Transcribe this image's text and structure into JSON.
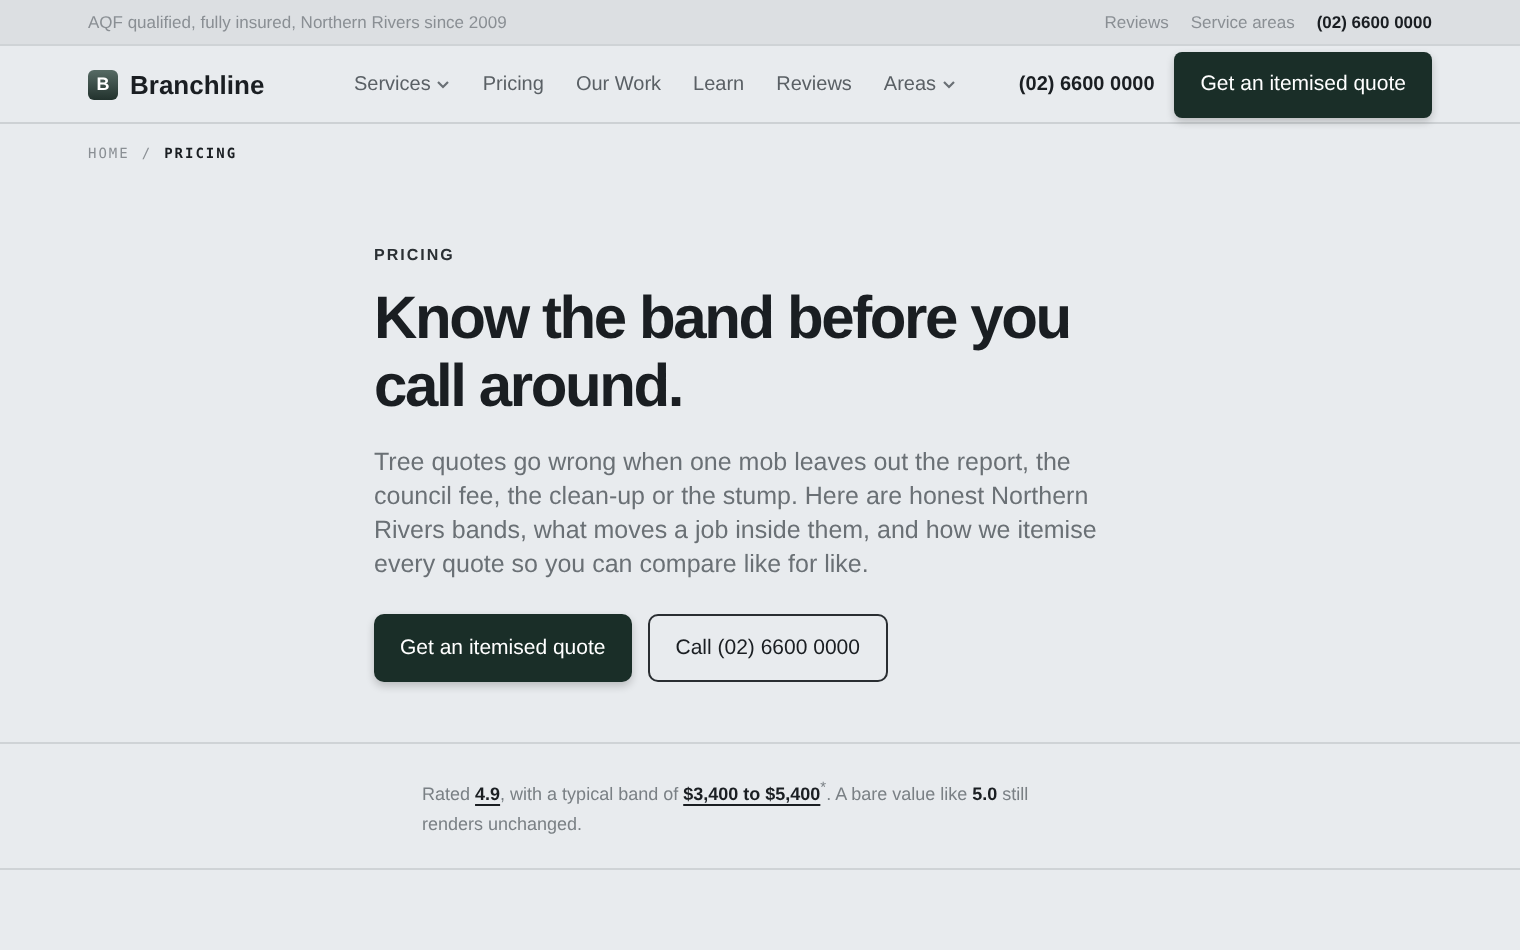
{
  "topbar": {
    "tagline": "AQF qualified, fully insured, Northern Rivers since 2009",
    "links": [
      "Reviews",
      "Service areas"
    ],
    "phone": "(02) 6600 0000"
  },
  "header": {
    "logo_letter": "B",
    "brand": "Branchline",
    "nav": [
      {
        "label": "Services",
        "dropdown": true
      },
      {
        "label": "Pricing",
        "dropdown": false
      },
      {
        "label": "Our Work",
        "dropdown": false
      },
      {
        "label": "Learn",
        "dropdown": false
      },
      {
        "label": "Reviews",
        "dropdown": false
      },
      {
        "label": "Areas",
        "dropdown": true
      }
    ],
    "phone": "(02) 6600 0000",
    "cta": "Get an itemised quote"
  },
  "breadcrumb": [
    {
      "label": "HOME",
      "current": false
    },
    {
      "label": "PRICING",
      "current": true
    }
  ],
  "breadcrumb_separator": "/",
  "hero": {
    "eyebrow": "PRICING",
    "title": "Know the band before you call around.",
    "lead": "Tree quotes go wrong when one mob leaves out the report, the council fee, the clean-up or the stump. Here are honest Northern Rivers bands, what moves a job inside them, and how we itemise every quote so you can compare like for like.",
    "buttons": [
      {
        "label": "Get an itemised quote",
        "kind": "primary"
      },
      {
        "label": "Call (02) 6600 0000",
        "kind": "secondary"
      }
    ]
  },
  "note": "Rated **4.9**, with a typical band of **$3,400 to $5,400**$^{*}$. A bare value like **5.0** still renders unchanged."
}
